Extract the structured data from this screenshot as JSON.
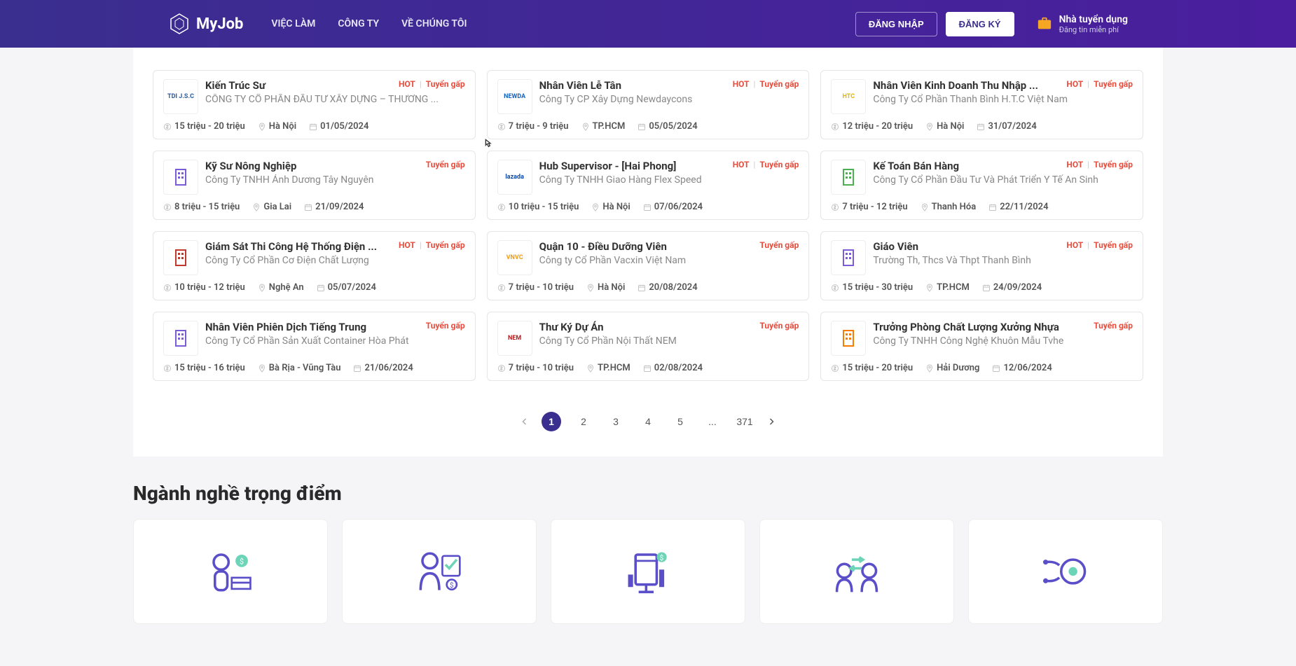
{
  "brand": "MyJob",
  "nav": {
    "jobs": "VIỆC LÀM",
    "companies": "CÔNG TY",
    "about": "VỀ CHÚNG TÔI"
  },
  "auth": {
    "login": "ĐĂNG NHẬP",
    "register": "ĐĂNG KÝ"
  },
  "employer": {
    "title": "Nhà tuyển dụng",
    "sub": "Đăng tin miễn phí"
  },
  "jobs": [
    {
      "title": "Kiến Trúc Sư",
      "company": "CÔNG TY CỔ PHẦN ĐẦU TƯ XÂY DỰNG – THƯƠNG ...",
      "salary": "15 triệu - 20 triệu",
      "location": "Hà Nội",
      "date": "01/05/2024",
      "hot": true,
      "urgent": true,
      "logoText": "TDI J.S.C",
      "logoColor": "#2a5aa0"
    },
    {
      "title": "Nhân Viên Lễ Tân",
      "company": "Công Ty CP Xây Dựng Newdaycons",
      "salary": "7 triệu - 9 triệu",
      "location": "TP.HCM",
      "date": "05/05/2024",
      "hot": true,
      "urgent": true,
      "logoText": "NEWDA",
      "logoColor": "#1565c0"
    },
    {
      "title": "Nhân Viên Kinh Doanh Thu Nhập ...",
      "company": "Công Ty Cổ Phần Thanh Bình H.T.C Việt Nam",
      "salary": "12 triệu - 20 triệu",
      "location": "Hà Nội",
      "date": "31/07/2024",
      "hot": true,
      "urgent": true,
      "logoText": "HTC",
      "logoColor": "#e6b800"
    },
    {
      "title": "Kỹ Sư Nông Nghiệp",
      "company": "Công Ty TNHH Ánh Dương Tây Nguyên",
      "salary": "8 triệu - 15 triệu",
      "location": "Gia Lai",
      "date": "21/09/2024",
      "hot": false,
      "urgent": true,
      "logoText": "",
      "logoColor": "#7b5cd6"
    },
    {
      "title": "Hub Supervisor - [Hai Phong]",
      "company": "Công Ty TNHH Giao Hàng Flex Speed",
      "salary": "10 triệu - 15 triệu",
      "location": "Hà Nội",
      "date": "07/06/2024",
      "hot": true,
      "urgent": true,
      "logoText": "lazada",
      "logoColor": "#0d47a1"
    },
    {
      "title": "Kế Toán Bán Hàng",
      "company": "Công Ty Cổ Phần Đầu Tư Và Phát Triển Y Tế An Sinh",
      "salary": "7 triệu - 12 triệu",
      "location": "Thanh Hóa",
      "date": "22/11/2024",
      "hot": true,
      "urgent": true,
      "logoText": "",
      "logoColor": "#4caf50"
    },
    {
      "title": "Giám Sát Thi Công Hệ Thống Điện ...",
      "company": "Công Ty Cổ Phần Cơ Điện Chất Lượng",
      "salary": "10 triệu - 12 triệu",
      "location": "Nghệ An",
      "date": "05/07/2024",
      "hot": true,
      "urgent": true,
      "logoText": "",
      "logoColor": "#c0392b"
    },
    {
      "title": "Quận 10 - Điều Dưỡng Viên",
      "company": "Công ty Cổ Phần Vacxin Việt Nam",
      "salary": "7 triệu - 10 triệu",
      "location": "Hà Nội",
      "date": "20/08/2024",
      "hot": false,
      "urgent": true,
      "logoText": "VNVC",
      "logoColor": "#f39c12"
    },
    {
      "title": "Giáo Viên",
      "company": "Trường Th, Thcs Và Thpt Thanh Bình",
      "salary": "15 triệu - 30 triệu",
      "location": "TP.HCM",
      "date": "24/09/2024",
      "hot": true,
      "urgent": true,
      "logoText": "",
      "logoColor": "#7b5cd6"
    },
    {
      "title": "Nhân Viên Phiên Dịch Tiếng Trung",
      "company": "Công Ty Cổ Phần Sản Xuất Container Hòa Phát",
      "salary": "15 triệu - 16 triệu",
      "location": "Bà Rịa - Vũng Tàu",
      "date": "21/06/2024",
      "hot": false,
      "urgent": true,
      "logoText": "",
      "logoColor": "#7b5cd6"
    },
    {
      "title": "Thư Ký Dự Án",
      "company": "Công Ty Cổ Phần Nội Thất NEM",
      "salary": "7 triệu - 10 triệu",
      "location": "TP.HCM",
      "date": "02/08/2024",
      "hot": false,
      "urgent": true,
      "logoText": "NEM",
      "logoColor": "#b71c1c"
    },
    {
      "title": "Trưởng Phòng Chất Lượng Xưởng Nhựa",
      "company": "Công Ty TNHH Công Nghệ Khuôn Mẫu Tvhe",
      "salary": "15 triệu - 20 triệu",
      "location": "Hải Dương",
      "date": "12/06/2024",
      "hot": false,
      "urgent": true,
      "logoText": "",
      "logoColor": "#f57c00"
    }
  ],
  "labels": {
    "hot": "HOT",
    "urgent": "Tuyển gấp"
  },
  "pagination": {
    "pages": [
      "1",
      "2",
      "3",
      "4",
      "5",
      "...",
      "371"
    ],
    "active": "1"
  },
  "section": {
    "categories_title": "Ngành nghề trọng điểm"
  }
}
